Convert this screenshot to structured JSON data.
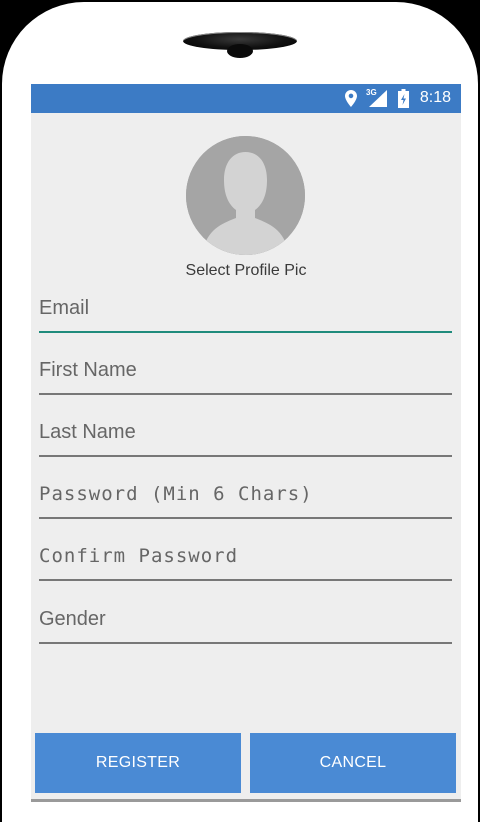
{
  "status_bar": {
    "network": "3G",
    "time": "8:18",
    "icons": [
      "location-icon",
      "signal-icon",
      "battery-charging-icon"
    ]
  },
  "profile": {
    "select_label": "Select Profile Pic"
  },
  "form": {
    "email_placeholder": "Email",
    "first_name_placeholder": "First Name",
    "last_name_placeholder": "Last Name",
    "password_placeholder": "Password (Min 6 Chars)",
    "confirm_password_placeholder": "Confirm Password",
    "gender_placeholder": "Gender"
  },
  "buttons": {
    "register_label": "REGISTER",
    "cancel_label": "CANCEL"
  },
  "colors": {
    "status_bar": "#3c7bc5",
    "button": "#4a8ad4",
    "focus_underline": "#1f8b7c",
    "background": "#eeeeee"
  }
}
